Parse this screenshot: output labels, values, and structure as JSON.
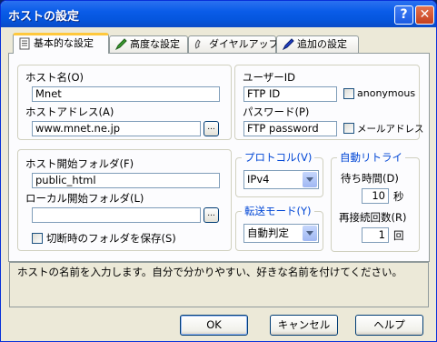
{
  "window": {
    "title": "ホストの設定",
    "help_glyph": "?",
    "close_glyph": "✕"
  },
  "tabs": [
    {
      "label": "基本的な設定",
      "icon": "document-icon",
      "active": true
    },
    {
      "label": "高度な設定",
      "icon": "pen-icon",
      "active": false
    },
    {
      "label": "ダイヤルアップ",
      "icon": "phone-icon",
      "active": false
    },
    {
      "label": "追加の設定",
      "icon": "marker-icon",
      "active": false
    }
  ],
  "host": {
    "name_label": "ホスト名(O)",
    "name_value": "Mnet",
    "address_label": "ホストアドレス(A)",
    "address_value": "www.mnet.ne.jp"
  },
  "account": {
    "user_label": "ユーザーID",
    "user_value": "FTP ID",
    "anonymous_label": "anonymous",
    "password_label": "パスワード(P)",
    "password_value": "FTP password",
    "mail_label": "メールアドレス"
  },
  "folders": {
    "host_folder_label": "ホスト開始フォルダ(F)",
    "host_folder_value": "public_html",
    "local_folder_label": "ローカル開始フォルダ(L)",
    "local_folder_value": "",
    "save_label": "切断時のフォルダを保存(S)"
  },
  "protocol": {
    "label": "プロトコル(V)",
    "value": "IPv4"
  },
  "transfer": {
    "label": "転送モード(Y)",
    "value": "自動判定"
  },
  "retry": {
    "label": "自動リトライ",
    "wait_label": "待ち時間(D)",
    "wait_value": "10",
    "wait_unit": "秒",
    "count_label": "再接続回数(R)",
    "count_value": "1",
    "count_unit": "回"
  },
  "ellipsis": "...",
  "status_text": "ホストの名前を入力します。自分で分かりやすい、好きな名前を付けてください。",
  "buttons": {
    "ok": "OK",
    "cancel": "キャンセル",
    "help": "ヘルプ"
  }
}
